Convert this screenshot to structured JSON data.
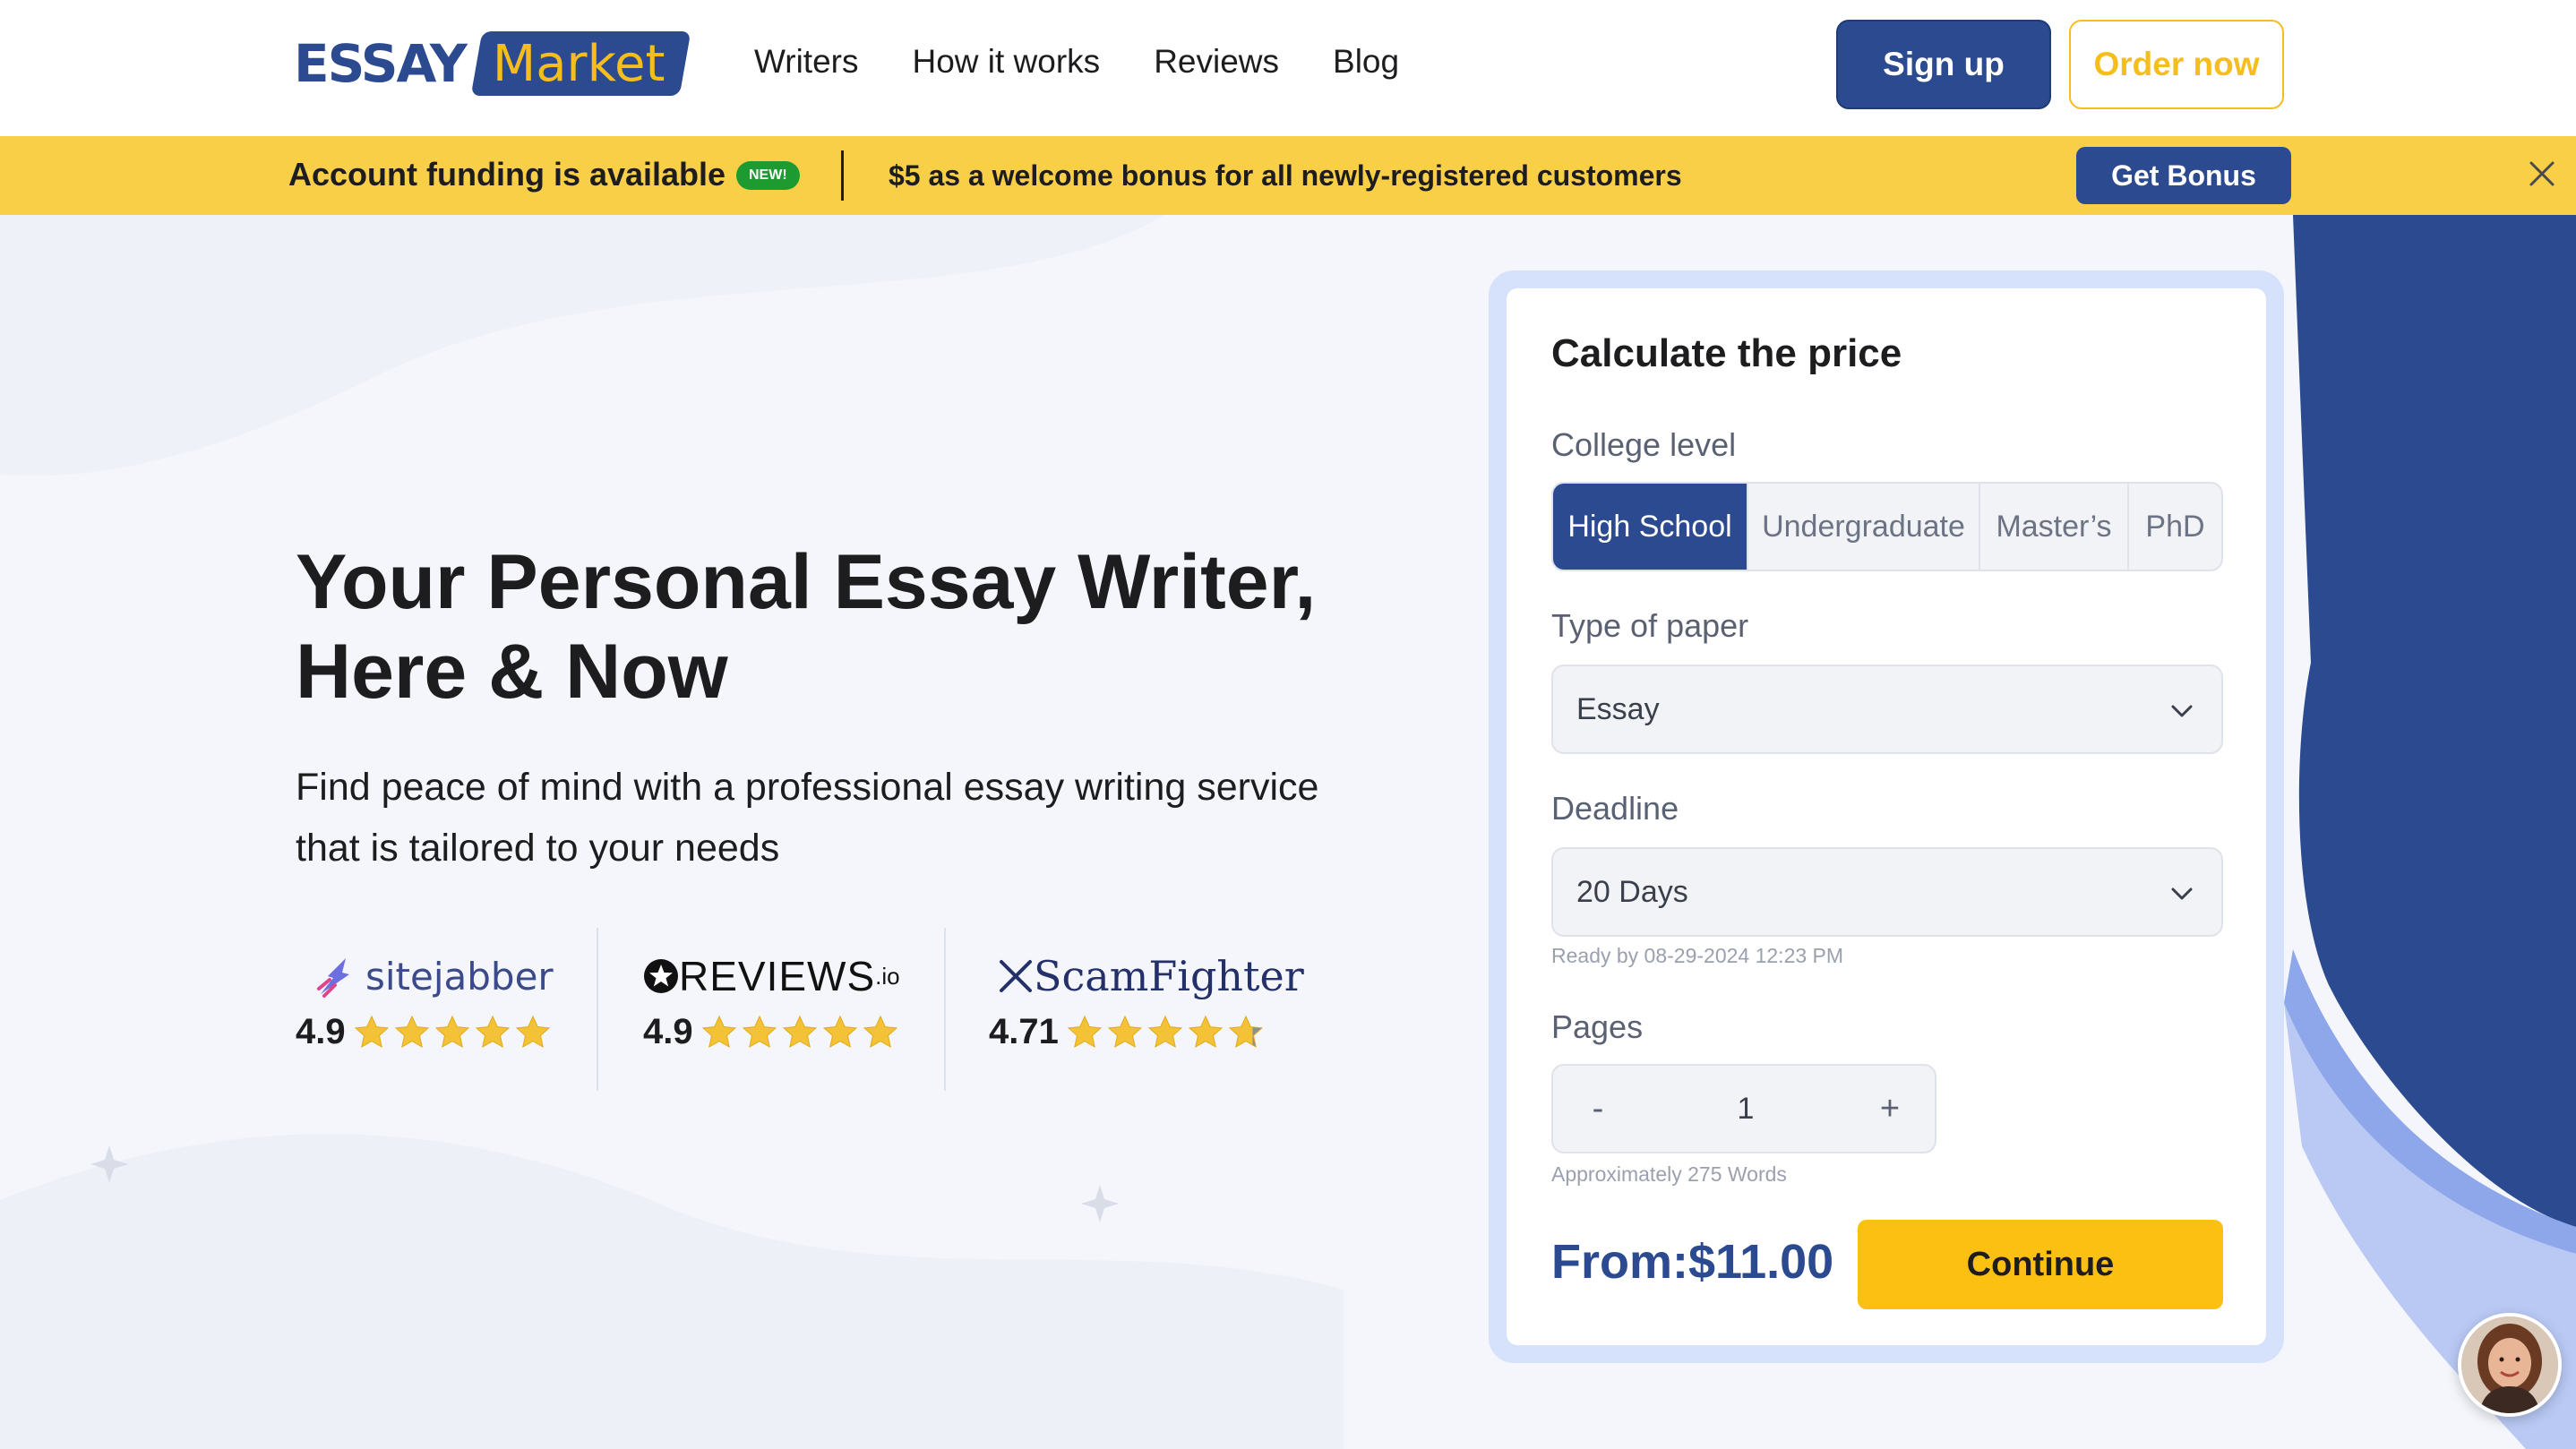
{
  "header": {
    "logo_part1": "ESSAY",
    "logo_part2": "Market",
    "nav": [
      "Writers",
      "How it works",
      "Reviews",
      "Blog"
    ],
    "signup_label": "Sign up",
    "order_label": "Order now"
  },
  "promo": {
    "title": "Account funding is available",
    "badge": "NEW!",
    "text": "$5 as a welcome bonus for all newly-registered customers",
    "button": "Get Bonus"
  },
  "hero": {
    "title_line1": "Your Personal Essay Writer,",
    "title_line2": "Here & Now",
    "subtitle_line1": "Find peace of mind with a professional essay writing service",
    "subtitle_line2": "that is tailored to your needs"
  },
  "ratings": [
    {
      "site": "sitejabber",
      "score": "4.9",
      "stars": 5
    },
    {
      "site": "REVIEWS",
      "site_suffix": ".io",
      "score": "4.9",
      "stars": 5
    },
    {
      "site": "ScamFighter",
      "score": "4.71",
      "stars": 4.71
    }
  ],
  "calculator": {
    "title": "Calculate the price",
    "college_label": "College level",
    "levels": [
      "High School",
      "Undergraduate",
      "Master’s",
      "PhD"
    ],
    "selected_level": "High School",
    "paper_label": "Type of paper",
    "paper_value": "Essay",
    "deadline_label": "Deadline",
    "deadline_value": "20 Days",
    "ready_by": "Ready by 08-29-2024 12:23 PM",
    "pages_label": "Pages",
    "minus": "-",
    "pages_value": "1",
    "plus": "+",
    "words_hint": "Approximately 275 Words",
    "price_label": "From:",
    "price_value": "$11.00",
    "continue_label": "Continue"
  },
  "colors": {
    "brand_blue": "#2c4a8f",
    "brand_yellow": "#f6be1d",
    "promo_bg": "#f9cf47",
    "continue_bg": "#fcc012"
  }
}
